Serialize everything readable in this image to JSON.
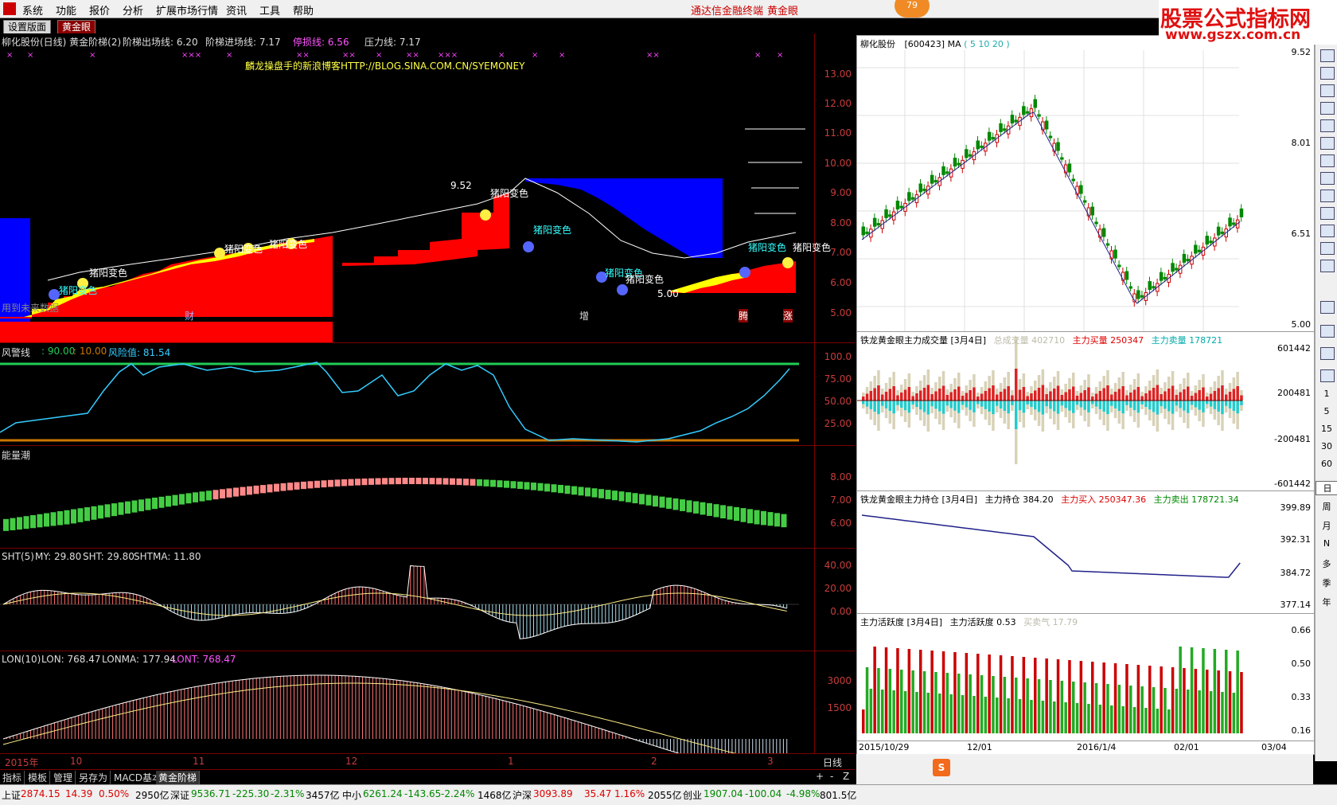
{
  "menu": {
    "items": [
      "系统",
      "功能",
      "报价",
      "分析",
      "扩展市场行情",
      "资讯",
      "工具",
      "帮助"
    ],
    "app_title": "通达信金融终端",
    "app_sub": "黄金眼",
    "badge": "79"
  },
  "site_banner": {
    "line1": "股票公式指标网",
    "line2": "www.gszx.com.cn"
  },
  "tabs": [
    "设置版面",
    "黄金眼"
  ],
  "main_panel": {
    "header": {
      "name": "柳化股份(日线) 黄金阶梯(2)",
      "exit_line": "阶梯出场线: 6.20",
      "entry_line": "阶梯进场线: 7.17",
      "stop_line": "停损线: 6.56",
      "pressure_line": "压力线: 7.17"
    },
    "watermark": "麟龙操盘手的新浪博客HTTP://BLOG.SINA.COM.CN/SYEMONEY",
    "y_ticks": [
      "13.00",
      "12.00",
      "11.00",
      "10.00",
      "9.00",
      "8.00",
      "7.00",
      "6.00",
      "5.00"
    ],
    "annotations": {
      "signal": "猪阳变色",
      "high": "9.52",
      "low": "5.00",
      "future": "用到未来数据",
      "cai": "财",
      "zeng": "增",
      "teng": "腾",
      "zhang": "涨"
    },
    "colors": {
      "red": "#ff0000",
      "yellow": "#ffff00",
      "blue": "#0000ff",
      "cyan": "#33ffff"
    }
  },
  "risk_panel": {
    "title": "风警线",
    "v1": ": 90.00",
    "v2": ": 10.00",
    "risk": "风险值: 81.54",
    "y_ticks": [
      "100.0",
      "75.00",
      "50.00",
      "25.00"
    ]
  },
  "energy_panel": {
    "title": "能量潮",
    "y_ticks": [
      "8.00",
      "7.00",
      "6.00"
    ]
  },
  "sht_panel": {
    "title": "SHT(5)",
    "my": "MY: 29.80",
    "sht": "SHT: 29.80",
    "shtma": "SHTMA: 11.80",
    "y_ticks": [
      "40.00",
      "20.00",
      "0.00"
    ]
  },
  "lon_panel": {
    "title": "LON(10)",
    "lon": "LON: 768.47",
    "lonma": "LONMA: 177.94",
    "lont": "LONT: 768.47",
    "y_ticks": [
      "3000",
      "1500"
    ]
  },
  "x_axis": {
    "labels": [
      "2015年",
      "10",
      "11",
      "12",
      "1",
      "2",
      "3"
    ],
    "period": "日线"
  },
  "right": {
    "price": {
      "title": "柳化股份",
      "code": "[600423]",
      "ma": "MA",
      "ma_params": "( 5 10 20 )",
      "y_ticks": [
        "9.52",
        "8.01",
        "6.51",
        "5.00"
      ]
    },
    "volume": {
      "title": "铁龙黄金眼主力成交量 [3月4日]",
      "total_label": "总成交量",
      "total": "402710",
      "buy_label": "主力买量",
      "buy": "250347",
      "sell_label": "主力卖量",
      "sell": "178721",
      "y_ticks": [
        "601442",
        "200481",
        "-200481",
        "-601442"
      ]
    },
    "position": {
      "title": "铁龙黄金眼主力持仓 [3月4日]",
      "hold_label": "主力持仓",
      "hold": "384.20",
      "buy_label": "主力买入",
      "buy": "250347.36",
      "sell_label": "主力卖出",
      "sell": "178721.34",
      "y_ticks": [
        "399.89",
        "392.31",
        "384.72",
        "377.14"
      ]
    },
    "activity": {
      "title": "主力活跃度 [3月4日]",
      "act_label": "主力活跃度",
      "act": "0.53",
      "mood_label": "买卖气",
      "mood": "17.79",
      "y_ticks": [
        "0.66",
        "0.50",
        "0.33",
        "0.16"
      ]
    },
    "x_labels": [
      "2015/10/29",
      "12/01",
      "2016/1/4",
      "02/01",
      "03/04"
    ]
  },
  "sidebar": {
    "nums": [
      "1",
      "5",
      "15",
      "30",
      "60"
    ],
    "periods": [
      "日",
      "周",
      "月",
      "N",
      "多",
      "季",
      "年"
    ]
  },
  "bottom_tabs": [
    "指标",
    "模板",
    "管理",
    "另存为",
    "MACD基本",
    "黄金阶梯"
  ],
  "status": {
    "sh_label": "上证",
    "sh": "2874.15",
    "sh_chg": "14.39",
    "sh_pct": "0.50%",
    "sh_amt": "2950亿",
    "sz_label": "深证",
    "sz": "9536.71",
    "sz_chg": "-225.30",
    "sz_pct": "-2.31%",
    "sz_amt": "3457亿",
    "zx_label": "中小",
    "zx": "6261.24",
    "zx_chg": "-143.65",
    "zx_pct": "-2.24%",
    "zx_amt": "1468亿",
    "hs_label": "沪深",
    "hs": "3093.89",
    "hs_chg": "35.47",
    "hs_pct": "1.16%",
    "hs_amt": "2055亿",
    "cy_label": "创业",
    "cy": "1907.04",
    "cy_chg": "-100.04",
    "cy_pct": "-4.98%",
    "cy_amt": "801.5亿"
  }
}
